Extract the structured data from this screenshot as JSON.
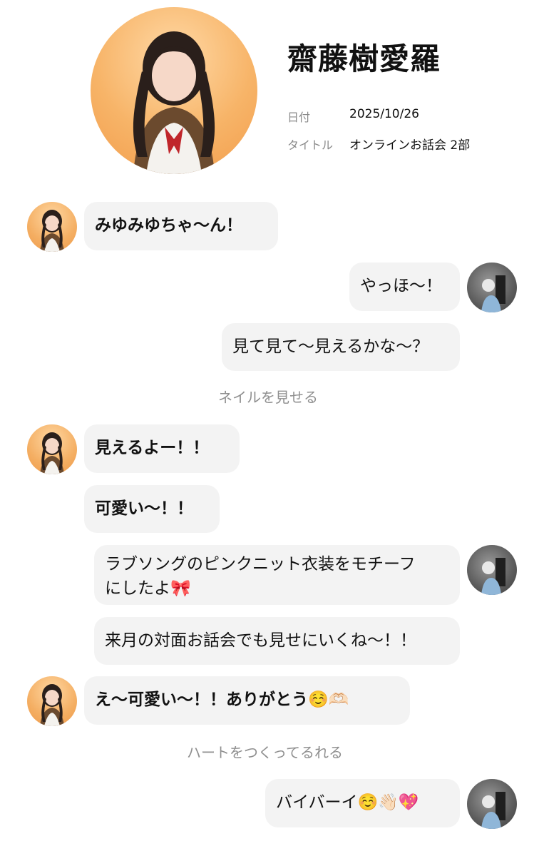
{
  "header": {
    "idol_name": "齋藤樹愛羅",
    "date_label": "日付",
    "date_value": "2025/10/26",
    "title_label": "タイトル",
    "title_value": "オンラインお話会 2部",
    "avatar_icon": "idol-portrait"
  },
  "colors": {
    "bubble_bg": "#f3f3f3",
    "action_text": "#8f8f8f",
    "idol_avatar_bg": "#f4ae62",
    "fan_avatar_bg": "#5c5c5c"
  },
  "messages": [
    {
      "sender": "idol",
      "text": "みゆみゆちゃ〜ん！"
    },
    {
      "sender": "fan",
      "text": "やっほ〜！"
    },
    {
      "sender": "fan",
      "text": "見て見て〜見えるかな〜？"
    },
    {
      "sender": "action",
      "text": "ネイルを見せる"
    },
    {
      "sender": "idol",
      "text": "見えるよー！！"
    },
    {
      "sender": "idol",
      "text": "可愛い〜！！"
    },
    {
      "sender": "fan",
      "line1": "ラブソングのピンクニット衣装をモチーフ",
      "line2": "にしたよ🎀"
    },
    {
      "sender": "fan",
      "text": "来月の対面お話会でも見せにいくね〜！！"
    },
    {
      "sender": "idol",
      "text": "え〜可愛い〜！！ありがとう☺️🫶🏻"
    },
    {
      "sender": "action",
      "text": "ハートをつくってるれる"
    },
    {
      "sender": "fan",
      "text": "バイバーイ☺️👋🏻💖"
    }
  ]
}
